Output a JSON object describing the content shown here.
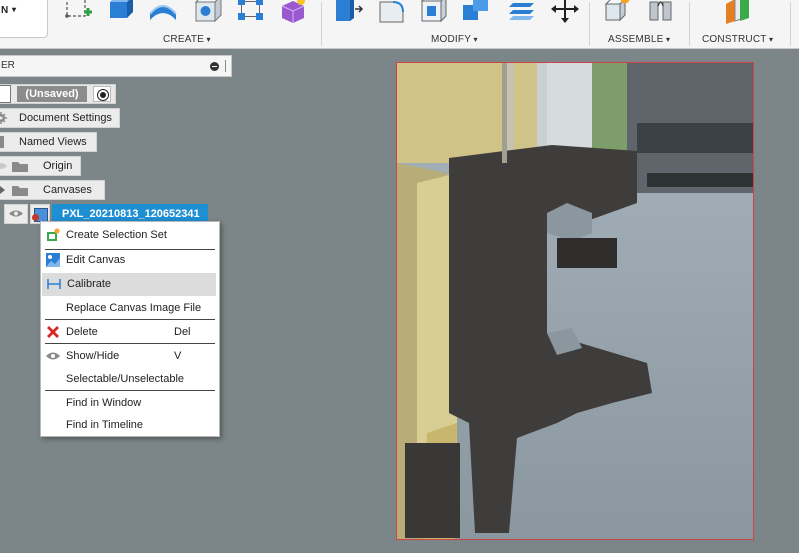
{
  "toolbar": {
    "design_label": "N",
    "groups": {
      "create": "CREATE",
      "modify": "MODIFY",
      "assemble": "ASSEMBLE",
      "construct": "CONSTRUCT"
    }
  },
  "browser": {
    "header_label": "ER",
    "document_name": "(Unsaved)",
    "nodes": {
      "document_settings": "Document Settings",
      "named_views": "Named Views",
      "origin": "Origin",
      "canvases": "Canvases"
    },
    "canvas_item": "PXL_20210813_120652341"
  },
  "context_menu": {
    "items": [
      {
        "label": "Create Selection Set",
        "shortcut": ""
      },
      {
        "label": "Edit Canvas",
        "shortcut": ""
      },
      {
        "label": "Calibrate",
        "shortcut": ""
      },
      {
        "label": "Replace Canvas Image File",
        "shortcut": ""
      },
      {
        "label": "Delete",
        "shortcut": "Del"
      },
      {
        "label": "Show/Hide",
        "shortcut": "V"
      },
      {
        "label": "Selectable/Unselectable",
        "shortcut": ""
      },
      {
        "label": "Find in Window",
        "shortcut": ""
      },
      {
        "label": "Find in Timeline",
        "shortcut": ""
      }
    ],
    "highlighted": "Calibrate"
  },
  "colors": {
    "selection": "#1f8fd3",
    "viewport": "#7c8688",
    "canvas_border": "#cc4444"
  }
}
